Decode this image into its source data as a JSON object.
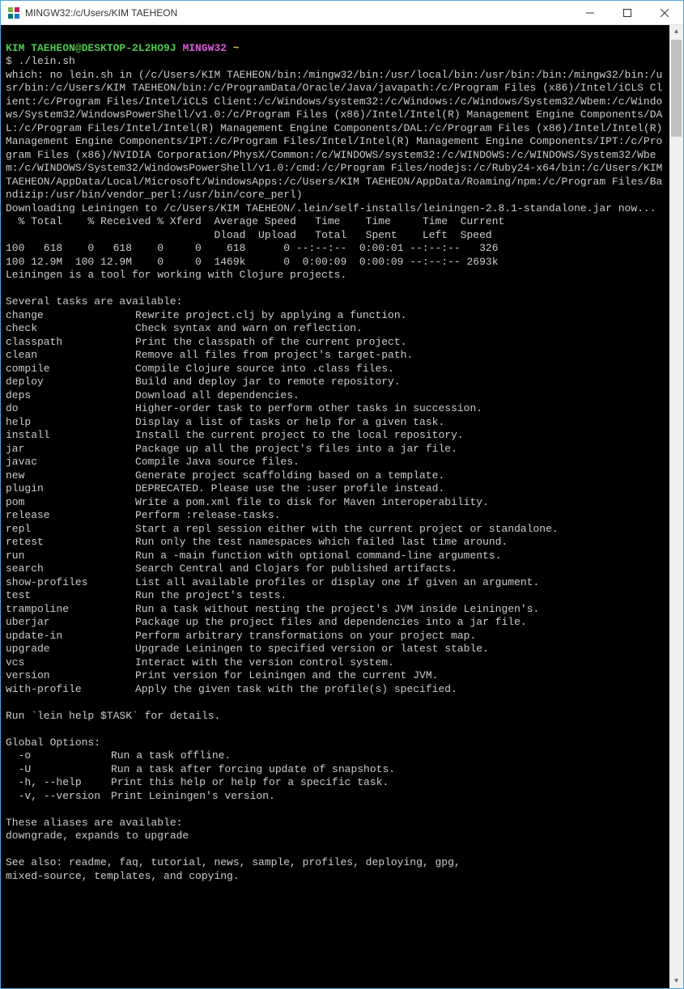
{
  "window": {
    "title": "MINGW32:/c/Users/KIM TAEHEON"
  },
  "prompt": {
    "user_host": "KIM TAEHEON@DESKTOP-2L2HO9J",
    "shell": "MINGW32",
    "path": "~",
    "symbol": "$",
    "command": "./lein.sh"
  },
  "which_output": "which: no lein.sh in (/c/Users/KIM TAEHEON/bin:/mingw32/bin:/usr/local/bin:/usr/bin:/bin:/mingw32/bin:/usr/bin:/c/Users/KIM TAEHEON/bin:/c/ProgramData/Oracle/Java/javapath:/c/Program Files (x86)/Intel/iCLS Client:/c/Program Files/Intel/iCLS Client:/c/Windows/system32:/c/Windows:/c/Windows/System32/Wbem:/c/Windows/System32/WindowsPowerShell/v1.0:/c/Program Files (x86)/Intel/Intel(R) Management Engine Components/DAL:/c/Program Files/Intel/Intel(R) Management Engine Components/DAL:/c/Program Files (x86)/Intel/Intel(R) Management Engine Components/IPT:/c/Program Files/Intel/Intel(R) Management Engine Components/IPT:/c/Program Files (x86)/NVIDIA Corporation/PhysX/Common:/c/WINDOWS/system32:/c/WINDOWS:/c/WINDOWS/System32/Wbem:/c/WINDOWS/System32/WindowsPowerShell/v1.0:/cmd:/c/Program Files/nodejs:/c/Ruby24-x64/bin:/c/Users/KIM TAEHEON/AppData/Local/Microsoft/WindowsApps:/c/Users/KIM TAEHEON/AppData/Roaming/npm:/c/Program Files/Bandizip:/usr/bin/vendor_perl:/usr/bin/core_perl)",
  "download_line": "Downloading Leiningen to /c/Users/KIM TAEHEON/.lein/self-installs/leiningen-2.8.1-standalone.jar now...",
  "curl_header": "  % Total    % Received % Xferd  Average Speed   Time    Time     Time  Current\n                                 Dload  Upload   Total   Spent    Left  Speed",
  "curl_rows": [
    "100   618    0   618    0     0    618      0 --:--:--  0:00:01 --:--:--   326",
    "100 12.9M  100 12.9M    0     0  1469k      0  0:00:09  0:00:09 --:--:-- 2693k"
  ],
  "lein_intro": "Leiningen is a tool for working with Clojure projects.",
  "tasks_header": "Several tasks are available:",
  "tasks": [
    {
      "name": "change",
      "desc": "Rewrite project.clj by applying a function."
    },
    {
      "name": "check",
      "desc": "Check syntax and warn on reflection."
    },
    {
      "name": "classpath",
      "desc": "Print the classpath of the current project."
    },
    {
      "name": "clean",
      "desc": "Remove all files from project's target-path."
    },
    {
      "name": "compile",
      "desc": "Compile Clojure source into .class files."
    },
    {
      "name": "deploy",
      "desc": "Build and deploy jar to remote repository."
    },
    {
      "name": "deps",
      "desc": "Download all dependencies."
    },
    {
      "name": "do",
      "desc": "Higher-order task to perform other tasks in succession."
    },
    {
      "name": "help",
      "desc": "Display a list of tasks or help for a given task."
    },
    {
      "name": "install",
      "desc": "Install the current project to the local repository."
    },
    {
      "name": "jar",
      "desc": "Package up all the project's files into a jar file."
    },
    {
      "name": "javac",
      "desc": "Compile Java source files."
    },
    {
      "name": "new",
      "desc": "Generate project scaffolding based on a template."
    },
    {
      "name": "plugin",
      "desc": "DEPRECATED. Please use the :user profile instead."
    },
    {
      "name": "pom",
      "desc": "Write a pom.xml file to disk for Maven interoperability."
    },
    {
      "name": "release",
      "desc": "Perform :release-tasks."
    },
    {
      "name": "repl",
      "desc": "Start a repl session either with the current project or standalone."
    },
    {
      "name": "retest",
      "desc": "Run only the test namespaces which failed last time around."
    },
    {
      "name": "run",
      "desc": "Run a -main function with optional command-line arguments."
    },
    {
      "name": "search",
      "desc": "Search Central and Clojars for published artifacts."
    },
    {
      "name": "show-profiles",
      "desc": "List all available profiles or display one if given an argument."
    },
    {
      "name": "test",
      "desc": "Run the project's tests."
    },
    {
      "name": "trampoline",
      "desc": "Run a task without nesting the project's JVM inside Leiningen's."
    },
    {
      "name": "uberjar",
      "desc": "Package up the project files and dependencies into a jar file."
    },
    {
      "name": "update-in",
      "desc": "Perform arbitrary transformations on your project map."
    },
    {
      "name": "upgrade",
      "desc": "Upgrade Leiningen to specified version or latest stable."
    },
    {
      "name": "vcs",
      "desc": "Interact with the version control system."
    },
    {
      "name": "version",
      "desc": "Print version for Leiningen and the current JVM."
    },
    {
      "name": "with-profile",
      "desc": "Apply the given task with the profile(s) specified."
    }
  ],
  "help_hint": "Run `lein help $TASK` for details.",
  "global_header": "Global Options:",
  "options": [
    {
      "name": "  -o",
      "desc": "Run a task offline."
    },
    {
      "name": "  -U",
      "desc": "Run a task after forcing update of snapshots."
    },
    {
      "name": "  -h, --help",
      "desc": "Print this help or help for a specific task."
    },
    {
      "name": "  -v, --version",
      "desc": "Print Leiningen's version."
    }
  ],
  "aliases_header": "These aliases are available:",
  "aliases_line": "downgrade, expands to upgrade",
  "see_also": "See also: readme, faq, tutorial, news, sample, profiles, deploying, gpg,\nmixed-source, templates, and copying."
}
